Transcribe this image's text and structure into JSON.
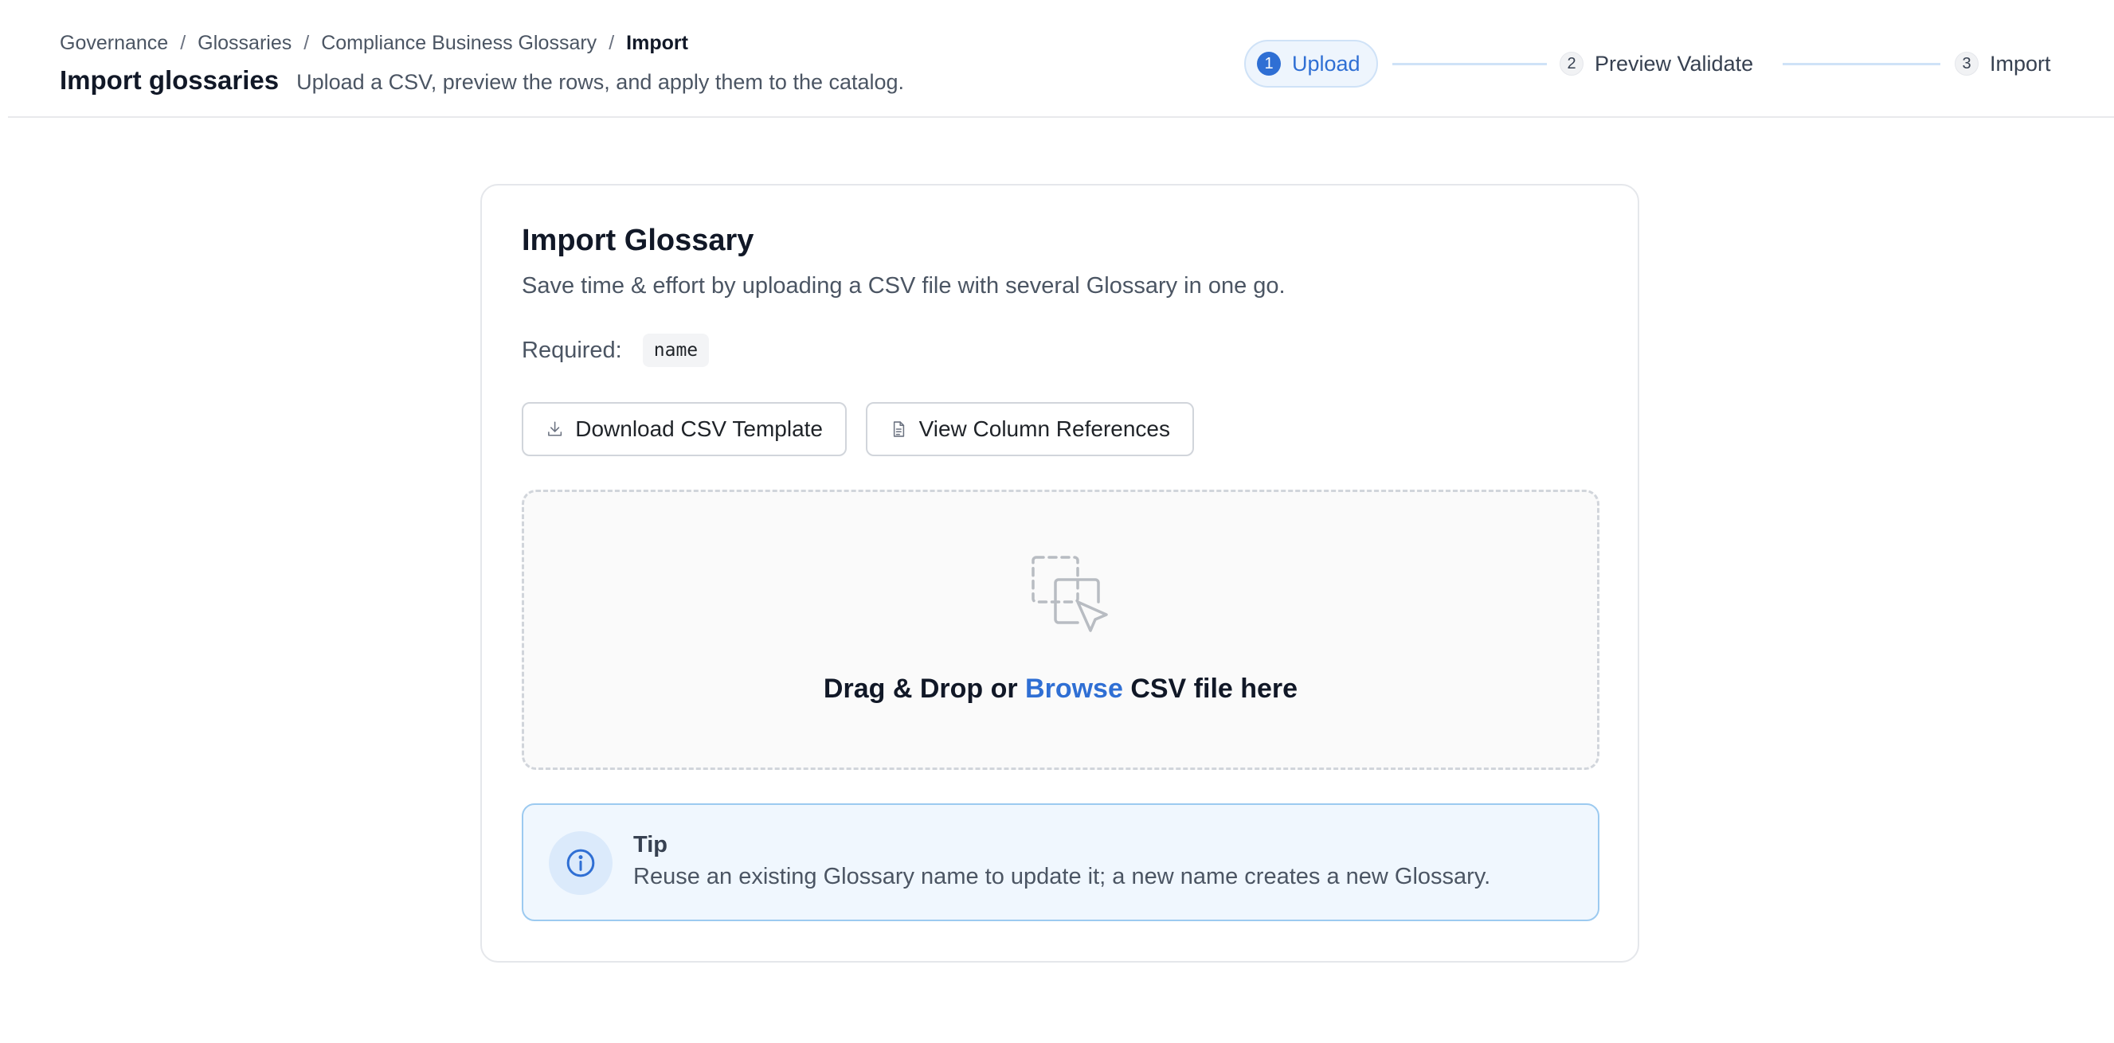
{
  "breadcrumb": {
    "items": [
      "Governance",
      "Glossaries",
      "Compliance Business Glossary"
    ],
    "separator": "/",
    "current": "Import"
  },
  "header": {
    "title": "Import glossaries",
    "subtitle": "Upload a CSV, preview the rows, and apply them to the catalog."
  },
  "stepper": {
    "steps": [
      {
        "number": "1",
        "label": "Upload",
        "state": "active"
      },
      {
        "number": "2",
        "label": "Preview Validate",
        "state": "inactive"
      },
      {
        "number": "3",
        "label": "Import",
        "state": "inactive"
      }
    ]
  },
  "card": {
    "title": "Import Glossary",
    "description": "Save time & effort by uploading a CSV file with several Glossary in one go.",
    "required_label": "Required:",
    "required_fields": [
      "name"
    ],
    "download_label": "Download CSV Template",
    "columns_label": "View Column References",
    "dropzone": {
      "prefix": "Drag & Drop or",
      "link": "Browse",
      "suffix": "CSV file here"
    },
    "tip": {
      "title": "Tip",
      "text": "Reuse an existing Glossary name to update it; a new name creates a new Glossary."
    }
  },
  "icons": {
    "download": "download-icon",
    "document": "document-icon",
    "drop": "drag-drop-icon",
    "info": "info-icon"
  },
  "colors": {
    "accent": "#2f6fd4",
    "tip_background": "#f0f7fe",
    "tip_border": "#9ccaf0"
  }
}
